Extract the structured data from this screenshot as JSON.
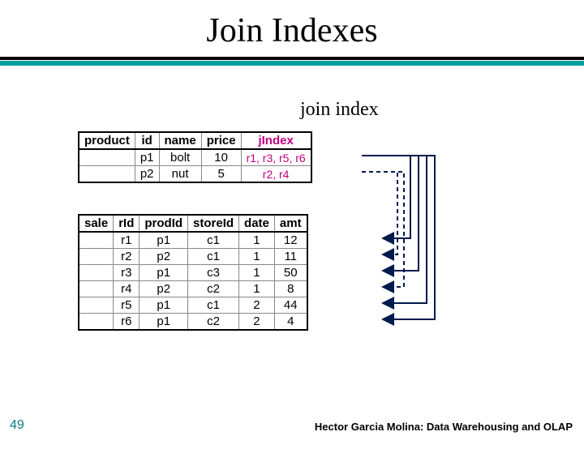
{
  "slide": {
    "title": "Join Indexes",
    "label_join": "join index",
    "page_number": "49",
    "footer": "Hector Garcia Molina: Data Warehousing and OLAP"
  },
  "product_table": {
    "headers": [
      "product",
      "id",
      "name",
      "price",
      "jIndex"
    ],
    "rows": [
      {
        "product": "",
        "id": "p1",
        "name": "bolt",
        "price": "10",
        "jindex": "r1, r3, r5, r6"
      },
      {
        "product": "",
        "id": "p2",
        "name": "nut",
        "price": "5",
        "jindex": "r2, r4"
      }
    ]
  },
  "sale_table": {
    "headers": [
      "sale",
      "rId",
      "prodId",
      "storeId",
      "date",
      "amt"
    ],
    "rows": [
      {
        "sale": "",
        "rId": "r1",
        "prodId": "p1",
        "storeId": "c1",
        "date": "1",
        "amt": "12"
      },
      {
        "sale": "",
        "rId": "r2",
        "prodId": "p2",
        "storeId": "c1",
        "date": "1",
        "amt": "11"
      },
      {
        "sale": "",
        "rId": "r3",
        "prodId": "p1",
        "storeId": "c3",
        "date": "1",
        "amt": "50"
      },
      {
        "sale": "",
        "rId": "r4",
        "prodId": "p2",
        "storeId": "c2",
        "date": "1",
        "amt": "8"
      },
      {
        "sale": "",
        "rId": "r5",
        "prodId": "p1",
        "storeId": "c1",
        "date": "2",
        "amt": "44"
      },
      {
        "sale": "",
        "rId": "r6",
        "prodId": "p1",
        "storeId": "c2",
        "date": "2",
        "amt": "4"
      }
    ]
  },
  "colors": {
    "accent_rule": "#009e9e",
    "jindex_text": "#c00080",
    "arrow_navy": "#001a4d",
    "page_num": "#0a7a7a"
  }
}
